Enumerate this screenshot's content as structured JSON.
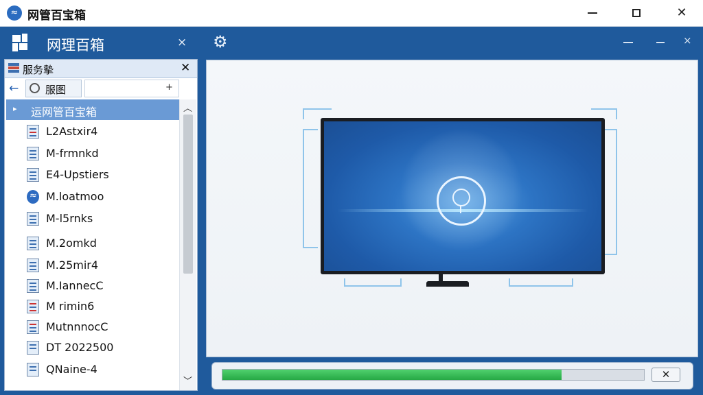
{
  "window": {
    "title": "网管百宝箱",
    "app_icon": "wrench-globe-icon"
  },
  "left_header": {
    "title": "网理百箱",
    "close": "×"
  },
  "panel": {
    "title": "服务摰",
    "close": "✕",
    "toolbar": {
      "back": "←",
      "tab_label": "服图",
      "add": "+"
    },
    "tree_root": {
      "label": "运网管百宝箱"
    },
    "tree_items": [
      {
        "label": "L2Astxir4",
        "icon": "document-icon"
      },
      {
        "label": "M-frmnkd",
        "icon": "document-icon"
      },
      {
        "label": "E4-Upstiers",
        "icon": "document-icon"
      },
      {
        "label": "M.loatmoo",
        "icon": "network-round-icon"
      },
      {
        "label": "M-l5rnks",
        "icon": "document-icon"
      },
      {
        "label": "M.2omkd",
        "icon": "document-icon"
      },
      {
        "label": "M.25mir4",
        "icon": "document-icon"
      },
      {
        "label": "M.IannecC",
        "icon": "document-icon"
      },
      {
        "label": "M rimin6",
        "icon": "spreadsheet-icon"
      },
      {
        "label": "MutnnnocC",
        "icon": "spreadsheet-icon"
      },
      {
        "label": "DT 2022500",
        "icon": "folder-icon"
      },
      {
        "label": "QNaine-4",
        "icon": "folder-icon"
      }
    ]
  },
  "right_header": {
    "settings_icon": "gear-icon"
  },
  "progress": {
    "percent": 80.5,
    "cancel": "✕"
  },
  "colors": {
    "brand": "#1f5a9c",
    "selection": "#6a9ad5",
    "progress": "#2fb24e"
  }
}
